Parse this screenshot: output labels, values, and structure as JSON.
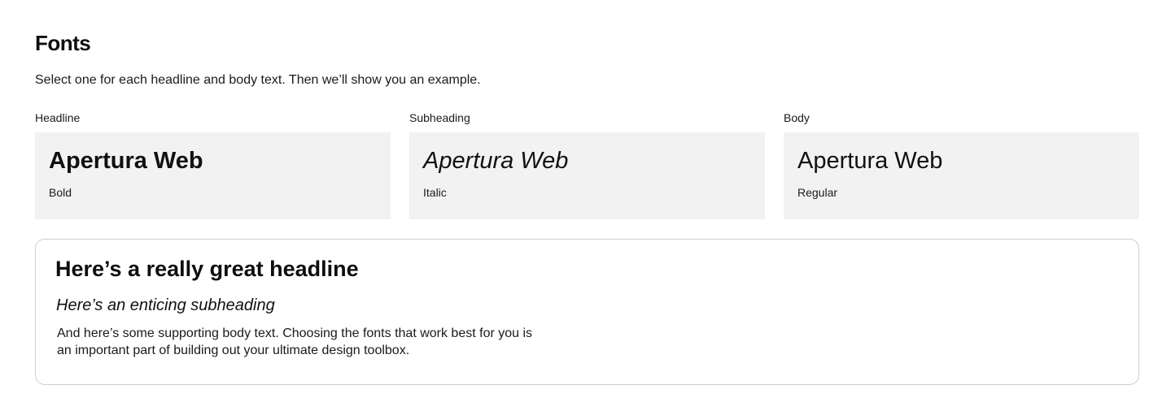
{
  "header": {
    "title": "Fonts",
    "subtitle": "Select one for each headline and body text. Then we’ll show you an example."
  },
  "font_choices": [
    {
      "label": "Headline",
      "font_name": "Apertura Web",
      "style": "Bold"
    },
    {
      "label": "Subheading",
      "font_name": "Apertura Web",
      "style": "Italic"
    },
    {
      "label": "Body",
      "font_name": "Apertura Web",
      "style": "Regular"
    }
  ],
  "preview": {
    "headline": "Here’s a really great headline",
    "subheading": "Here’s an enticing subheading",
    "body_line_1": "And here’s some supporting body text. Choosing the fonts that work best for you is",
    "body_line_2": "an important part of building out your ultimate design toolbox."
  },
  "colors": {
    "card_background": "#f2f2f2",
    "preview_border": "#cfcfcf",
    "text": "#111111"
  }
}
